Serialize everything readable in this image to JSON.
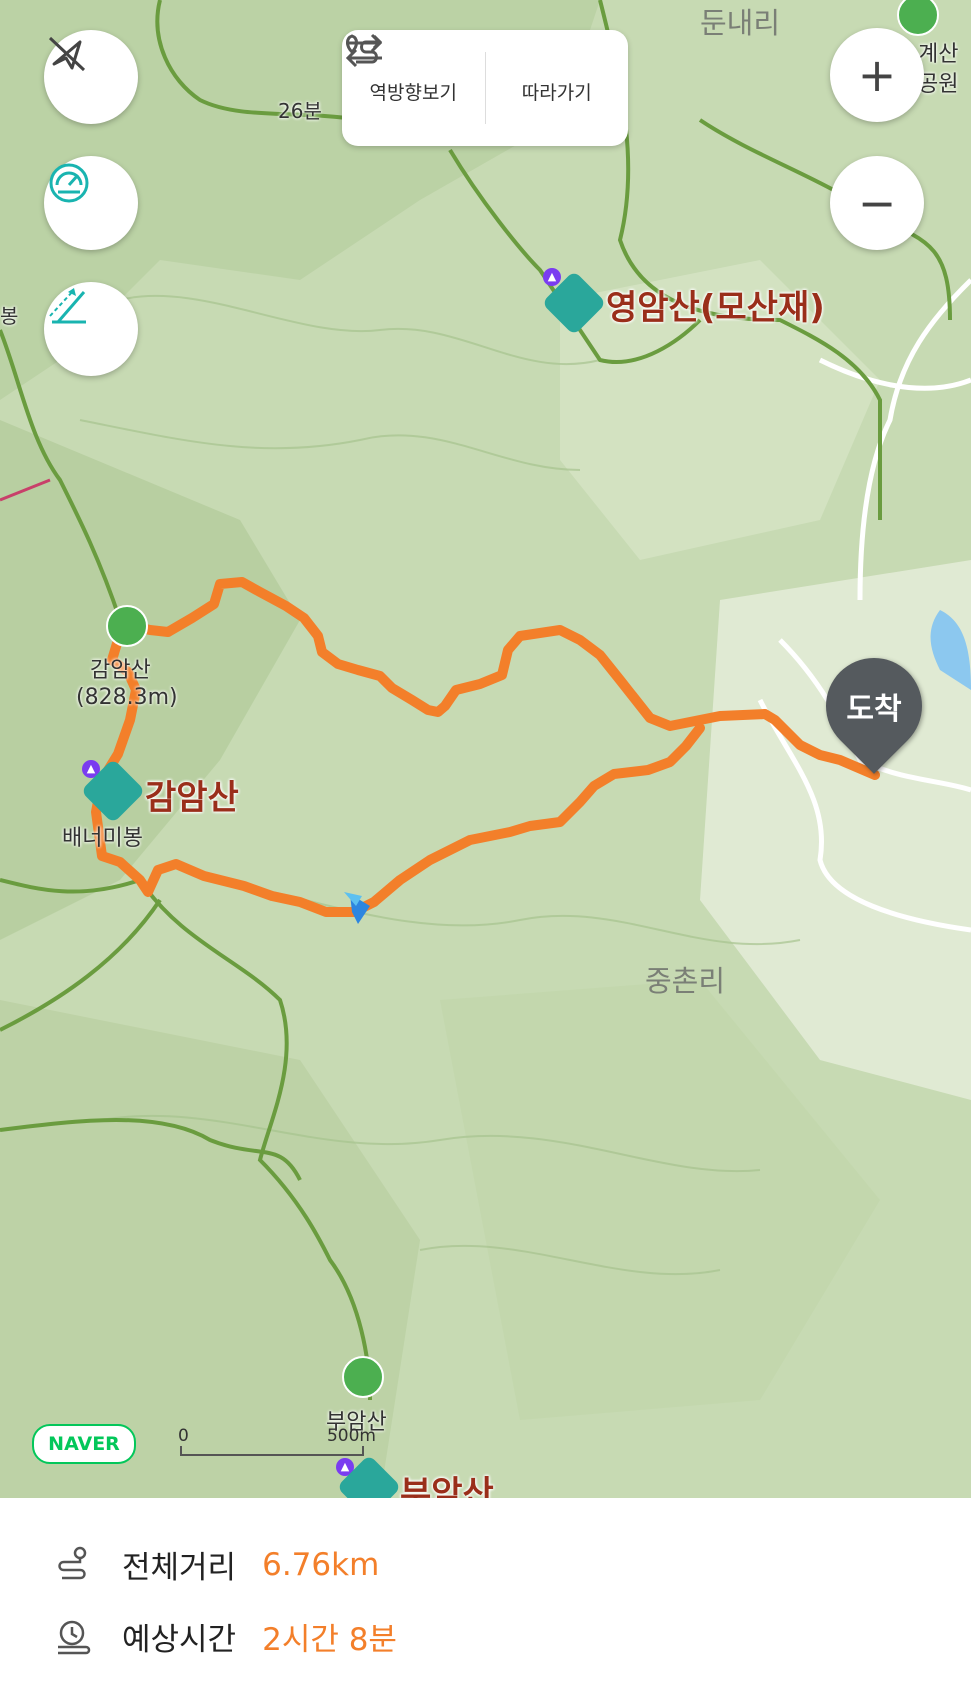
{
  "map": {
    "labels": {
      "yeongam": "영암산(모산재)",
      "gamam": "감암산",
      "gamam_peak": "감암산",
      "gamam_elev": "(828.3m)",
      "baenaemi": "배너미봉",
      "jungchon": "중촌리",
      "bonam_peak": "부암산",
      "bonam": "부암산",
      "dunnae": "둔내리",
      "park": "계산\n공원",
      "time_label": "26분",
      "left_edge": "봉"
    },
    "arrival": "도착",
    "naver_logo": "NAVER",
    "scale": {
      "start": "0",
      "distance": "500m"
    },
    "route_color": "#f37f2a"
  },
  "toolbar": {
    "reverse_label": "역방향보기",
    "follow_label": "따라가기"
  },
  "zoom": {
    "in_symbol": "+",
    "out_symbol": "−"
  },
  "left_controls": [
    "compass-off-icon",
    "speedometer-icon",
    "slope-icon"
  ],
  "summary": {
    "distance_label": "전체거리",
    "distance_value": "6.76km",
    "time_label": "예상시간",
    "time_value": "2시간 8분"
  }
}
